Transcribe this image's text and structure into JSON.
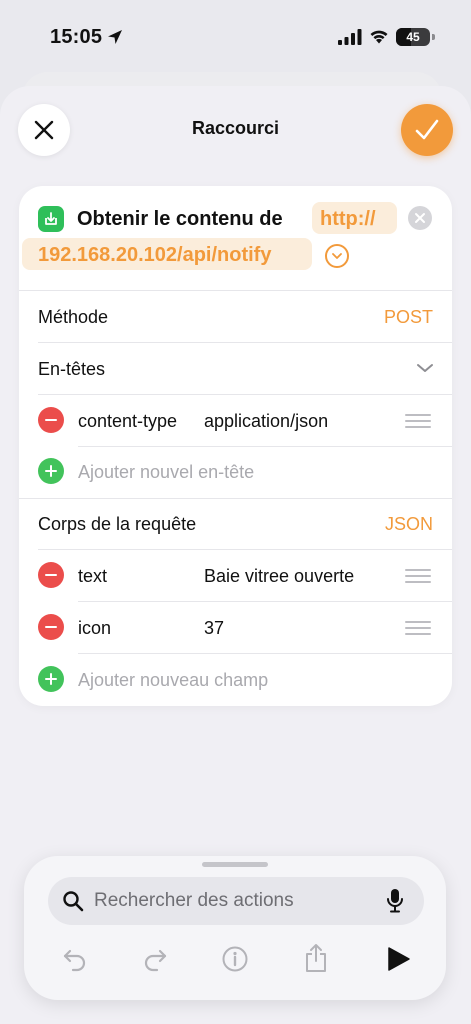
{
  "status_bar": {
    "time": "15:05",
    "battery_level": "45",
    "icons": [
      "location-arrow-icon",
      "cellular-signal-icon",
      "wifi-icon",
      "battery-icon"
    ]
  },
  "sheet": {
    "title": "Raccourci",
    "close_icon": "close-icon",
    "done_icon": "checkmark-icon"
  },
  "action": {
    "icon": "download-icon",
    "title": "Obtenir le contenu de",
    "url_part_1": "http://",
    "url_part_2": "192.168.20.102/api/notify",
    "method_label": "Méthode",
    "method_value": "POST",
    "headers_label": "En-têtes",
    "headers": [
      {
        "key": "content-type",
        "value": "application/json"
      }
    ],
    "add_header_placeholder": "Ajouter nouvel en-tête",
    "body_label": "Corps de la requête",
    "body_type": "JSON",
    "fields": [
      {
        "key": "text",
        "value": "Baie vitree ouverte"
      },
      {
        "key": "icon",
        "value": "37"
      }
    ],
    "add_field_placeholder": "Ajouter nouveau champ"
  },
  "toolbar": {
    "search_placeholder": "Rechercher des actions",
    "buttons": [
      "undo-icon",
      "redo-icon",
      "info-icon",
      "share-icon",
      "play-icon"
    ]
  },
  "colors": {
    "accent": "#f29a3b",
    "accent_chip": "#fbeddb",
    "destructive": "#eb4d4b",
    "add_green": "#42c35b",
    "action_green": "#2fbf5a"
  }
}
